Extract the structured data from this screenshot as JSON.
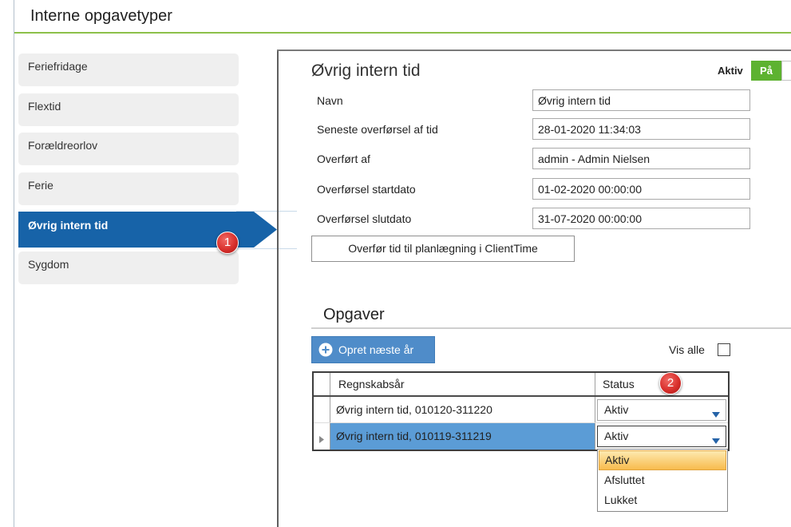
{
  "header": {
    "title": "Interne opgavetyper"
  },
  "sidebar": {
    "selected_index": 4,
    "items": [
      {
        "label": "Feriefridage"
      },
      {
        "label": "Flextid"
      },
      {
        "label": "Forældreorlov"
      },
      {
        "label": "Ferie"
      },
      {
        "label": "Øvrig intern tid"
      },
      {
        "label": "Sygdom"
      }
    ]
  },
  "callouts": [
    "1",
    "2"
  ],
  "detail": {
    "title": "Øvrig intern tid",
    "active_toggle": {
      "label": "Aktiv",
      "value_label": "På",
      "on": true
    },
    "fields": [
      {
        "label": "Navn",
        "value": "Øvrig intern tid"
      },
      {
        "label": "Seneste overførsel af tid",
        "value": "28-01-2020 11:34:03"
      },
      {
        "label": "Overført af",
        "value": "admin - Admin Nielsen"
      },
      {
        "label": "Overførsel startdato",
        "value": "01-02-2020 00:00:00"
      },
      {
        "label": "Overførsel slutdato",
        "value": "31-07-2020 00:00:00"
      }
    ],
    "transfer_button": "Overfør tid til planlægning i ClientTime"
  },
  "tasks": {
    "title": "Opgaver",
    "create_button": "Opret næste år",
    "show_all": {
      "label": "Vis alle",
      "checked": false
    },
    "columns": {
      "fiscal_year": "Regnskabsår",
      "status": "Status"
    },
    "rows": [
      {
        "fiscal_year": "Øvrig intern tid, 010120-311220",
        "status": "Aktiv",
        "selected": false
      },
      {
        "fiscal_year": "Øvrig intern tid, 010119-311219",
        "status": "Aktiv",
        "selected": true
      }
    ],
    "status_dropdown": {
      "open_row_index": 1,
      "highlighted_index": 0,
      "options": [
        "Aktiv",
        "Afsluttet",
        "Lukket"
      ]
    }
  },
  "icons": {
    "create_button": "plus-circle-icon",
    "status_dropdown": "triangle-down-icon",
    "current_row": "row-pointer-icon"
  },
  "colors": {
    "accent_green": "#8cc04a",
    "selected_blue": "#1763a8",
    "toggle_green": "#5db230",
    "button_blue": "#4f8cc9",
    "row_selected": "#5b9cd6",
    "badge_red": "#d9302c",
    "highlight_orange": "#f8bb4d"
  }
}
